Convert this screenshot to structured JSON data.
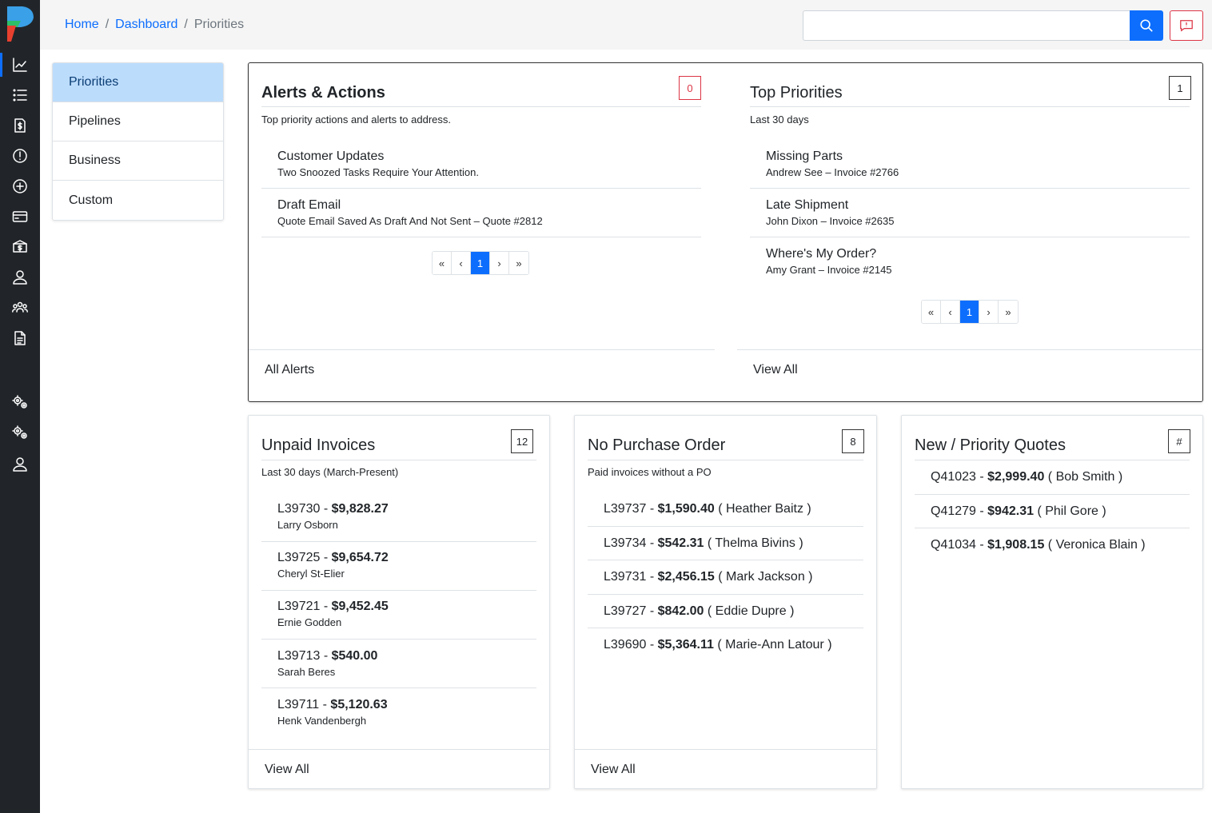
{
  "breadcrumb": {
    "home": "Home",
    "dashboard": "Dashboard",
    "current": "Priorities",
    "separator": "/"
  },
  "search": {
    "value": "",
    "placeholder": ""
  },
  "menu": {
    "items": [
      {
        "label": "Priorities"
      },
      {
        "label": "Pipelines"
      },
      {
        "label": "Business"
      },
      {
        "label": "Custom"
      }
    ]
  },
  "alerts": {
    "title": "Alerts & Actions",
    "count": "0",
    "subtitle": "Top priority actions and alerts to address.",
    "items": [
      {
        "title": "Customer Updates",
        "detail": "Two Snoozed Tasks Require Your Attention."
      },
      {
        "title": "Draft Email",
        "detail": "Quote Email Saved As Draft And Not Sent – Quote #2812"
      }
    ],
    "pager": {
      "first": "«",
      "prev": "‹",
      "page": "1",
      "next": "›",
      "last": "»"
    },
    "footer": "All Alerts"
  },
  "top_priorities": {
    "title": "Top Priorities",
    "count": "1",
    "subtitle": "Last 30 days",
    "items": [
      {
        "title": "Missing Parts",
        "detail": "Andrew See – Invoice #2766"
      },
      {
        "title": "Late Shipment",
        "detail": "John Dixon – Invoice #2635"
      },
      {
        "title": "Where's My Order?",
        "detail": "Amy Grant – Invoice #2145"
      }
    ],
    "pager": {
      "first": "«",
      "prev": "‹",
      "page": "1",
      "next": "›",
      "last": "»"
    },
    "footer": "View All"
  },
  "unpaid": {
    "title": "Unpaid Invoices",
    "count": "12",
    "subtitle": "Last 30 days (March-Present)",
    "items": [
      {
        "id": "L39730",
        "amount": "$9,828.27",
        "name": "Larry Osborn"
      },
      {
        "id": "L39725",
        "amount": "$9,654.72",
        "name": "Cheryl St-Elier"
      },
      {
        "id": "L39721",
        "amount": "$9,452.45",
        "name": "Ernie Godden"
      },
      {
        "id": "L39713",
        "amount": "$540.00",
        "name": "Sarah Beres"
      },
      {
        "id": "L39711",
        "amount": "$5,120.63",
        "name": "Henk Vandenbergh"
      }
    ],
    "footer": "View All"
  },
  "no_po": {
    "title": "No Purchase Order",
    "count": "8",
    "subtitle": "Paid invoices without a PO",
    "items": [
      {
        "id": "L39737",
        "amount": "$1,590.40",
        "name": "Heather Baitz"
      },
      {
        "id": "L39734",
        "amount": "$542.31",
        "name": "Thelma Bivins"
      },
      {
        "id": "L39731",
        "amount": "$2,456.15",
        "name": "Mark Jackson"
      },
      {
        "id": "L39727",
        "amount": "$842.00",
        "name": "Eddie Dupre"
      },
      {
        "id": "L39690",
        "amount": "$5,364.11",
        "name": "Marie-Ann Latour"
      }
    ],
    "footer": "View All"
  },
  "quotes": {
    "title": "New / Priority Quotes",
    "count": "#",
    "items": [
      {
        "id": "Q41023",
        "amount": "$2,999.40",
        "name": "Bob Smith"
      },
      {
        "id": "Q41279",
        "amount": "$942.31",
        "name": "Phil Gore"
      },
      {
        "id": "Q41034",
        "amount": "$1,908.15",
        "name": "Veronica Blain"
      }
    ]
  },
  "icons": {
    "rail": [
      "analytics-icon",
      "list-icon",
      "invoice-dollar-icon",
      "alert-circle-icon",
      "add-circle-icon",
      "credit-card-icon",
      "box-dollar-icon",
      "user-icon",
      "team-icon",
      "document-icon",
      "settings-gears-icon",
      "settings-gears-alt-icon",
      "account-icon"
    ],
    "search": "search-icon",
    "feedback": "message-alert-icon"
  },
  "colors": {
    "rail": "#212529",
    "accent": "#0d6efd",
    "active_menu": "#bcdcfc",
    "danger": "#dc3545",
    "topbar": "#f5f5f5"
  }
}
